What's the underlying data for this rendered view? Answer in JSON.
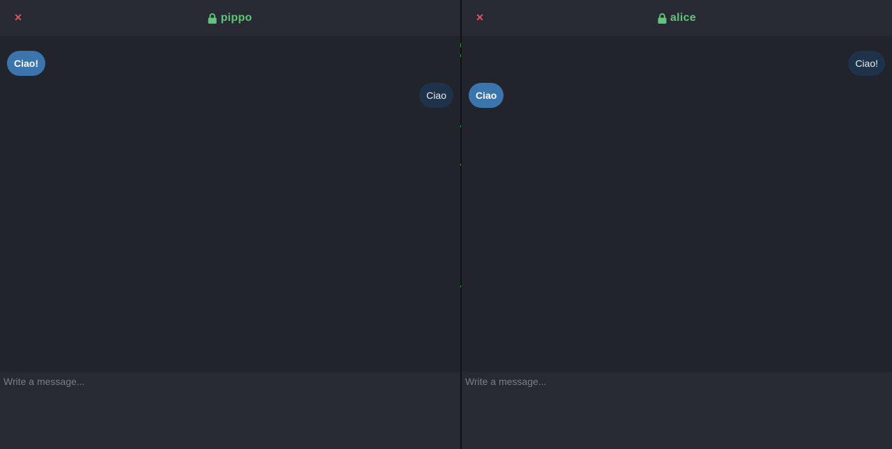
{
  "colors": {
    "accent_green": "#5fc57a",
    "close_red": "#e0535b",
    "incoming_bubble": "#3b75ad",
    "outgoing_bubble": "#1e324a",
    "header_bg": "#282a33",
    "body_bg": "#22242c"
  },
  "left_chat": {
    "title": "pippo",
    "close_icon": "×",
    "messages": [
      {
        "text": "Ciao!",
        "direction": "incoming"
      },
      {
        "text": "Ciao",
        "direction": "outgoing"
      }
    ],
    "composer": {
      "placeholder": "Write a message...",
      "value": ""
    }
  },
  "right_chat": {
    "title": "alice",
    "close_icon": "×",
    "messages": [
      {
        "text": "Ciao!",
        "direction": "outgoing"
      },
      {
        "text": "Ciao",
        "direction": "incoming"
      }
    ],
    "composer": {
      "placeholder": "Write a message...",
      "value": ""
    }
  }
}
